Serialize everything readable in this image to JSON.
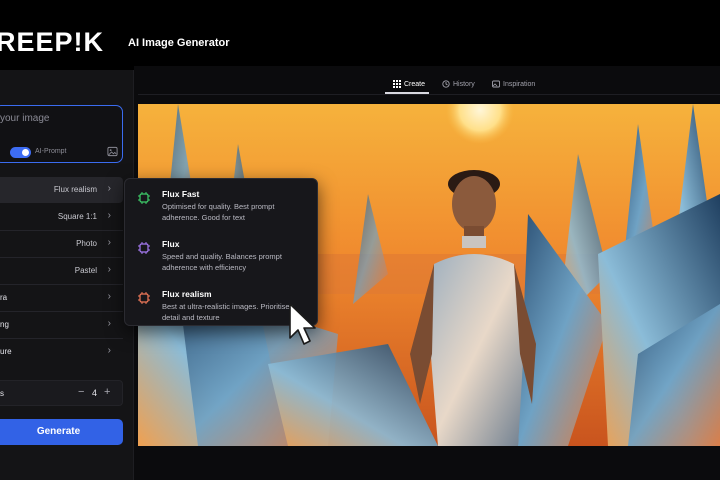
{
  "header": {
    "logo_text": "REEP!K",
    "app_title": "AI Image Generator"
  },
  "sidebar": {
    "prompt": {
      "placeholder": "your image"
    },
    "ai_prompt": {
      "label": "AI-Prompt",
      "enabled": true
    },
    "settings": [
      {
        "label": "",
        "value": "Flux realism"
      },
      {
        "label": "",
        "value": "Square 1:1"
      },
      {
        "label": "",
        "value": "Photo"
      },
      {
        "label": "",
        "value": "Pastel"
      },
      {
        "label": "ra",
        "value": ""
      },
      {
        "label": "ng",
        "value": ""
      },
      {
        "label": "ure",
        "value": ""
      }
    ],
    "image_count": {
      "label": "s",
      "value": "4",
      "minus": "−",
      "plus": "+"
    },
    "generate_label": "Generate"
  },
  "tabs": [
    {
      "label": "Create",
      "icon": "grid-icon",
      "active": true
    },
    {
      "label": "History",
      "icon": "history-icon",
      "active": false
    },
    {
      "label": "Inspiration",
      "icon": "image-icon",
      "active": false
    }
  ],
  "model_menu": {
    "options": [
      {
        "name": "Flux Fast",
        "description": "Optimised for quality. Best prompt adherence. Good for text",
        "icon_color": "#3ecf6a"
      },
      {
        "name": "Flux",
        "description": "Speed and quality. Balances prompt adherence with efficiency",
        "icon_color": "#a77bf5"
      },
      {
        "name": "Flux realism",
        "description": "Best at ultra-realistic images. Prioritises detail and texture",
        "icon_color": "#f27a5a"
      }
    ]
  },
  "colors": {
    "accent": "#3262e6",
    "sunset": "#f2a73a"
  }
}
